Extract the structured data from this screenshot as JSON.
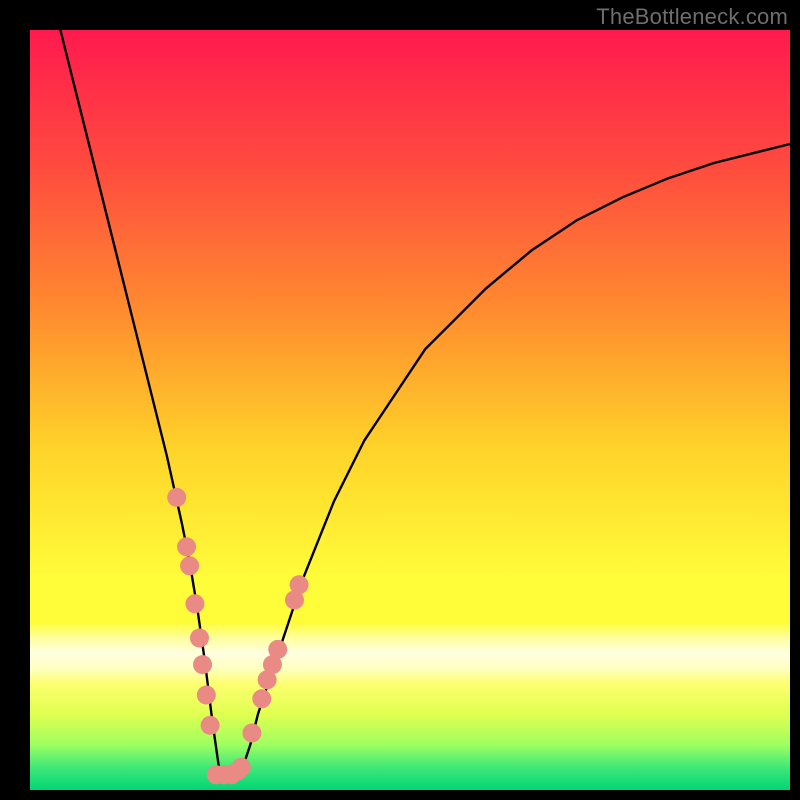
{
  "watermark": "TheBottleneck.com",
  "chart_data": {
    "type": "line",
    "title": "",
    "xlabel": "",
    "ylabel": "",
    "xlim": [
      0,
      100
    ],
    "ylim": [
      0,
      100
    ],
    "grid": false,
    "legend": false,
    "background": "rainbow-gradient",
    "series": [
      {
        "name": "bottleneck-curve",
        "kind": "line",
        "color": "#000000",
        "x": [
          4,
          6,
          8,
          10,
          12,
          14,
          16,
          18,
          20,
          21,
          22,
          23,
          24,
          25,
          26,
          27,
          28,
          29,
          30,
          32,
          34,
          36,
          38,
          40,
          44,
          48,
          52,
          56,
          60,
          66,
          72,
          78,
          84,
          90,
          96,
          100
        ],
        "y": [
          100,
          92,
          84,
          76,
          68,
          60,
          52,
          44,
          35,
          30,
          24,
          17,
          9,
          2,
          2,
          2,
          3,
          6,
          10,
          16,
          22,
          28,
          33,
          38,
          46,
          52,
          58,
          62,
          66,
          71,
          75,
          78,
          80.5,
          82.5,
          84,
          85
        ]
      },
      {
        "name": "data-points-left",
        "kind": "scatter",
        "color": "#e98a85",
        "x": [
          19.3,
          20.6,
          21.0,
          21.7,
          22.3,
          22.7,
          23.2,
          23.7
        ],
        "y": [
          38.5,
          32.0,
          29.5,
          24.5,
          20.0,
          16.5,
          12.5,
          8.5
        ]
      },
      {
        "name": "data-points-bottom",
        "kind": "scatter",
        "color": "#e98a85",
        "x": [
          24.5,
          25.5,
          26.5,
          27.3,
          27.8
        ],
        "y": [
          2.0,
          2.0,
          2.0,
          2.5,
          3.0
        ]
      },
      {
        "name": "data-points-right",
        "kind": "scatter",
        "color": "#e98a85",
        "x": [
          29.2,
          30.5,
          31.2,
          31.9,
          32.6,
          34.8,
          35.4
        ],
        "y": [
          7.5,
          12.0,
          14.5,
          16.5,
          18.5,
          25.0,
          27.0
        ]
      }
    ],
    "gradient_stops": [
      {
        "offset": 0.0,
        "color": "#ff1a4e"
      },
      {
        "offset": 0.18,
        "color": "#ff4b3f"
      },
      {
        "offset": 0.38,
        "color": "#ff8f2e"
      },
      {
        "offset": 0.55,
        "color": "#ffd329"
      },
      {
        "offset": 0.72,
        "color": "#fffc3a"
      },
      {
        "offset": 0.78,
        "color": "#fffc3a"
      },
      {
        "offset": 0.8,
        "color": "#ffffa0"
      },
      {
        "offset": 0.82,
        "color": "#ffffe0"
      },
      {
        "offset": 0.84,
        "color": "#ffffc0"
      },
      {
        "offset": 0.86,
        "color": "#fdff70"
      },
      {
        "offset": 0.9,
        "color": "#e0ff50"
      },
      {
        "offset": 0.94,
        "color": "#9fff60"
      },
      {
        "offset": 0.97,
        "color": "#40e878"
      },
      {
        "offset": 1.0,
        "color": "#00d676"
      }
    ]
  }
}
